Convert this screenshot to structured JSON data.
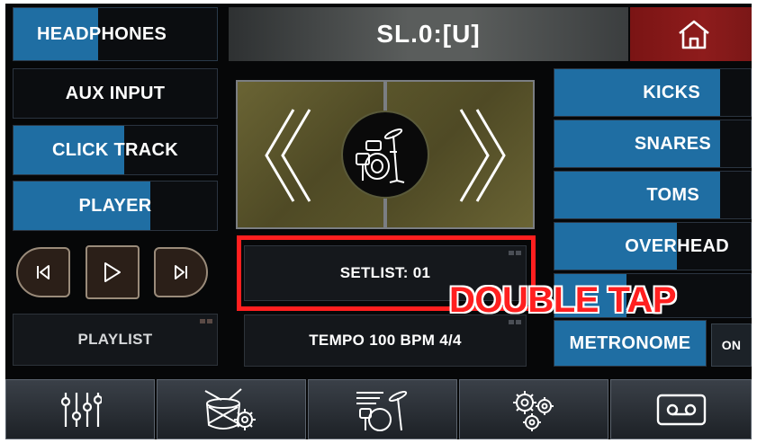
{
  "header": {
    "headphones_label": "HEADPHONES",
    "title": "SL.0:[U]",
    "home_icon": "home-icon"
  },
  "left": {
    "aux_input": "AUX INPUT",
    "click_track": "CLICK TRACK",
    "player": "PLAYER",
    "playlist": "PLAYLIST"
  },
  "transport": {
    "prev_icon": "skip-back-icon",
    "play_icon": "play-icon",
    "next_icon": "skip-forward-icon"
  },
  "kit_selector": {
    "prev_icon": "chevron-left-icon",
    "kit_icon": "drum-kit-icon",
    "next_icon": "chevron-right-icon"
  },
  "center": {
    "setlist": "SETLIST: 01",
    "tempo": "TEMPO 100 BPM 4/4"
  },
  "right": {
    "kicks": "KICKS",
    "snares": "SNARES",
    "toms": "TOMS",
    "overhead": "OVERHEAD",
    "metronome": "METRONOME",
    "metronome_toggle": "ON"
  },
  "overlay": {
    "double_tap": "DOUBLE TAP",
    "color": "#ff1f1f"
  },
  "bottom_bar": {
    "icons": [
      "mixer-sliders-icon",
      "drum-settings-icon",
      "kit-edit-icon",
      "settings-gears-icon",
      "cassette-icon"
    ]
  },
  "colors": {
    "accent_blue": "#1f6ea3",
    "home_red": "#8b1818",
    "kit_panel": "#5f5a2e"
  }
}
